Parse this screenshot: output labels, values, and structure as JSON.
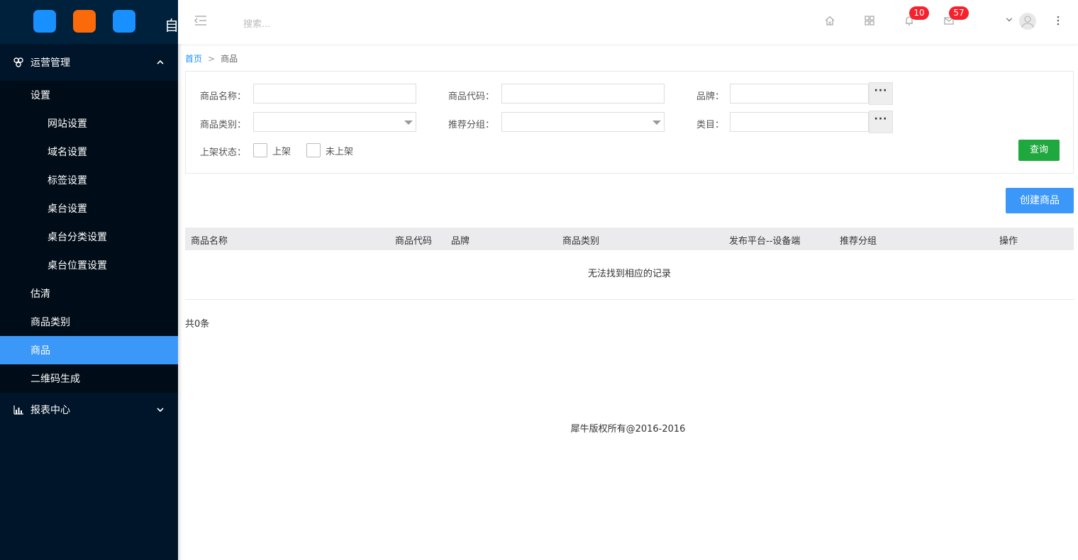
{
  "logo": {
    "text": "自"
  },
  "header": {
    "search_placeholder": "搜索...",
    "notifications_count": "10",
    "messages_count": "57"
  },
  "sidebar": {
    "group_ops": {
      "label": "运营管理"
    },
    "items": [
      {
        "label": "设置"
      },
      {
        "label": "网站设置"
      },
      {
        "label": "域名设置"
      },
      {
        "label": "标签设置"
      },
      {
        "label": "桌台设置"
      },
      {
        "label": "桌台分类设置"
      },
      {
        "label": "桌台位置设置"
      },
      {
        "label": "估清"
      },
      {
        "label": "商品类别"
      },
      {
        "label": "商品"
      },
      {
        "label": "二维码生成"
      }
    ],
    "group_reports": {
      "label": "报表中心"
    }
  },
  "breadcrumb": {
    "home": "首页",
    "separator": ">",
    "current": "商品"
  },
  "filter": {
    "name_label": "商品名称：",
    "code_label": "商品代码：",
    "brand_label": "品牌：",
    "category_label": "商品类别：",
    "group_label": "推荐分组：",
    "class_label": "类目：",
    "status_label": "上架状态：",
    "on_shelf": "上架",
    "off_shelf": "未上架",
    "dots": "···",
    "query_button": "查询"
  },
  "create_button": "创建商品",
  "table": {
    "columns": [
      "商品名称",
      "商品代码",
      "品牌",
      "商品类别",
      "发布平台--设备端",
      "推荐分组",
      "操作"
    ],
    "empty_text": "无法找到相应的记录"
  },
  "total_text": "共0条",
  "footer": "犀牛版权所有@2016-2016",
  "colors": {
    "sidebar_bg": "#001529",
    "active_item": "#3c98f8",
    "query_green": "#1fa83d",
    "badge_red": "#f5222d",
    "app_blue": "#1890ff",
    "app_orange": "#fa6a0a"
  }
}
